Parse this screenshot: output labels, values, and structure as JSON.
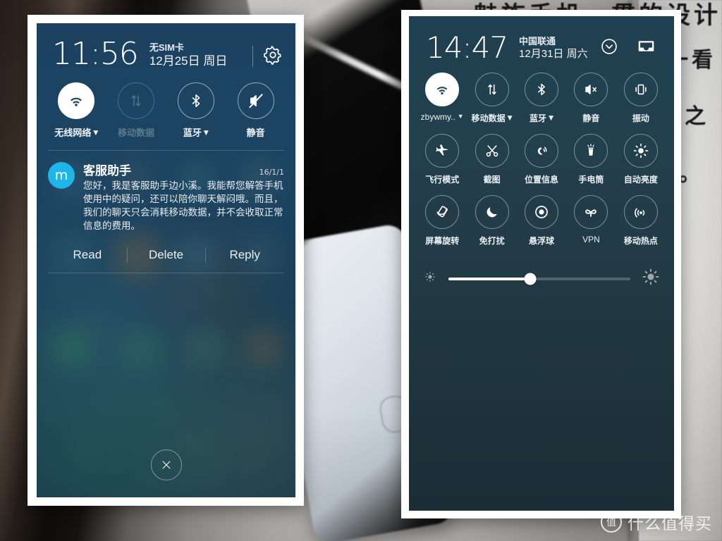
{
  "background": {
    "book_lines": [
      "魅族手机一贯的设计风",
      "一看",
      "看之",
      "同。"
    ]
  },
  "watermark": {
    "mark": "值",
    "text": "什么值得买"
  },
  "left_phone": {
    "status": {
      "time": "11:56",
      "carrier": "无SIM卡",
      "date": "12月25日 周日",
      "settings_icon": "gear-icon"
    },
    "toggles": [
      {
        "label": "无线网络",
        "icon": "wifi-icon",
        "state": "on",
        "has_caret": true
      },
      {
        "label": "移动数据",
        "icon": "mobile-data-icon",
        "state": "disabled",
        "has_caret": false
      },
      {
        "label": "蓝牙",
        "icon": "bluetooth-icon",
        "state": "off",
        "has_caret": true
      },
      {
        "label": "静音",
        "icon": "mute-icon",
        "state": "off",
        "has_caret": false
      }
    ],
    "notification": {
      "avatar_letter": "m",
      "title": "客服助手",
      "time": "16/1/1",
      "text": "您好，我是客服助手边小溪。我能帮您解答手机使用中的疑问，还可以陪你聊天解闷哦。而且，我们的聊天只会消耗移动数据，并不会收取正常信息的费用。",
      "actions": [
        "Read",
        "Delete",
        "Reply"
      ]
    },
    "close_button": "close-icon"
  },
  "right_phone": {
    "status": {
      "time": "14:47",
      "carrier": "中国联通",
      "date": "12月31日 周六",
      "icons": [
        "chevron-down-circle-icon",
        "inbox-icon"
      ]
    },
    "toggle_rows": [
      [
        {
          "label": "zbywmy..",
          "icon": "wifi-icon",
          "state": "on",
          "has_caret": true,
          "latin": true
        },
        {
          "label": "移动数据",
          "icon": "mobile-data-icon",
          "state": "off",
          "has_caret": true
        },
        {
          "label": "蓝牙",
          "icon": "bluetooth-icon",
          "state": "off",
          "has_caret": true
        },
        {
          "label": "静音",
          "icon": "mute-icon",
          "state": "off",
          "has_caret": false
        },
        {
          "label": "振动",
          "icon": "vibrate-icon",
          "state": "off",
          "has_caret": false
        }
      ],
      [
        {
          "label": "飞行模式",
          "icon": "airplane-icon",
          "state": "off",
          "has_caret": false
        },
        {
          "label": "截图",
          "icon": "scissors-icon",
          "state": "off",
          "has_caret": false
        },
        {
          "label": "位置信息",
          "icon": "location-icon",
          "state": "off",
          "has_caret": false
        },
        {
          "label": "手电筒",
          "icon": "flashlight-icon",
          "state": "off",
          "has_caret": false
        },
        {
          "label": "自动亮度",
          "icon": "brightness-auto-icon",
          "state": "off",
          "has_caret": false
        }
      ],
      [
        {
          "label": "屏幕旋转",
          "icon": "screen-rotate-icon",
          "state": "off",
          "has_caret": false
        },
        {
          "label": "免打扰",
          "icon": "moon-icon",
          "state": "off",
          "has_caret": false
        },
        {
          "label": "悬浮球",
          "icon": "floating-ball-icon",
          "state": "off",
          "has_caret": false
        },
        {
          "label": "VPN",
          "icon": "vpn-icon",
          "state": "off",
          "has_caret": false,
          "latin": true
        },
        {
          "label": "移动热点",
          "icon": "hotspot-icon",
          "state": "off",
          "has_caret": false
        }
      ]
    ],
    "brightness": {
      "low_icon": "brightness-low-icon",
      "high_icon": "brightness-high-icon",
      "value_percent": 45
    }
  }
}
